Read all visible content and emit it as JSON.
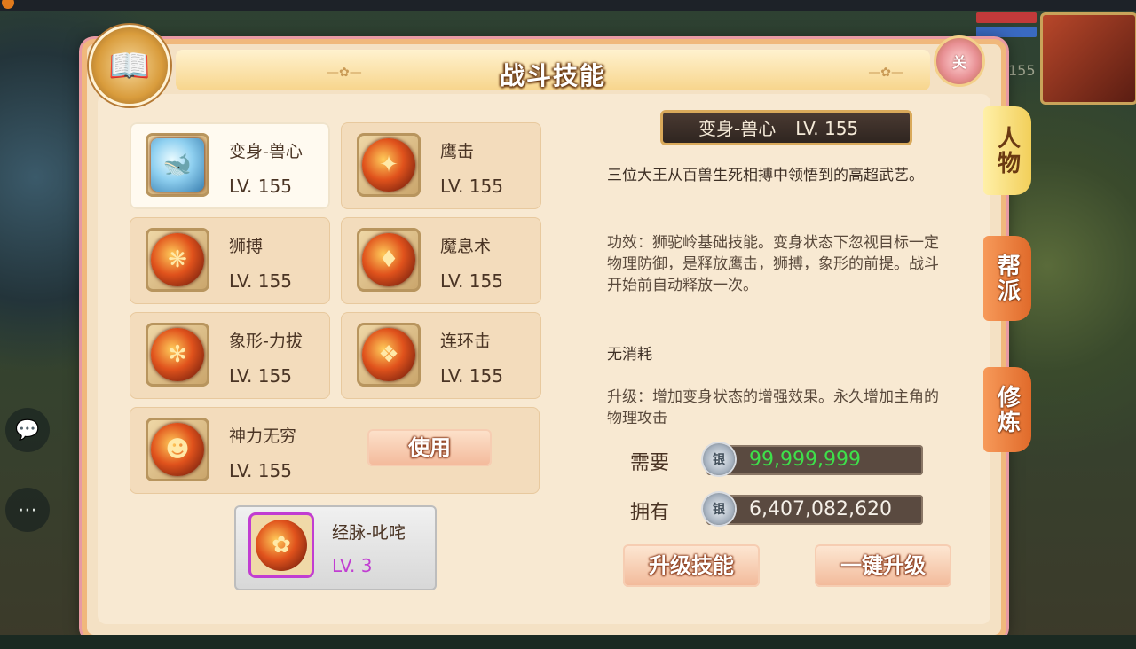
{
  "window": {
    "title": ""
  },
  "hud": {
    "level": "155"
  },
  "panel": {
    "title": "战斗技能",
    "close_label": "关"
  },
  "skills": [
    {
      "name": "变身-兽心",
      "level": "LV. 155",
      "icon": "shark-rider-icon",
      "selected": true
    },
    {
      "name": "鹰击",
      "level": "LV. 155",
      "icon": "eagle-strike-icon"
    },
    {
      "name": "狮搏",
      "level": "LV. 155",
      "icon": "lion-icon"
    },
    {
      "name": "魔息术",
      "level": "LV. 155",
      "icon": "demon-breath-icon"
    },
    {
      "name": "象形-力拔",
      "level": "LV. 155",
      "icon": "elephant-icon"
    },
    {
      "name": "连环击",
      "level": "LV. 155",
      "icon": "combo-strike-icon"
    },
    {
      "name": "神力无穷",
      "level": "LV. 155",
      "icon": "divine-power-icon"
    }
  ],
  "use_button": "使用",
  "meridian": {
    "name": "经脉-叱咤",
    "level": "LV. 3",
    "icon": "phoenix-icon"
  },
  "detail": {
    "name": "变身-兽心",
    "level": "LV. 155",
    "intro": "三位大王从百兽生死相搏中领悟到的高超武艺。",
    "effect": "功效：狮驼岭基础技能。变身状态下忽视目标一定物理防御，是释放鹰击，狮搏，象形的前提。战斗开始前自动释放一次。",
    "cost": "无消耗",
    "upgrade": "升级：增加变身状态的增强效果。永久增加主角的物理攻击"
  },
  "resources": {
    "need_label": "需要",
    "need_value": "99,999,999",
    "have_label": "拥有",
    "have_value": "6,407,082,620"
  },
  "actions": {
    "upgrade": "升级技能",
    "one_click": "一键升级"
  },
  "tabs": [
    {
      "label": "人物",
      "active": true
    },
    {
      "label": "帮派",
      "active": false
    },
    {
      "label": "修炼",
      "active": false
    }
  ]
}
